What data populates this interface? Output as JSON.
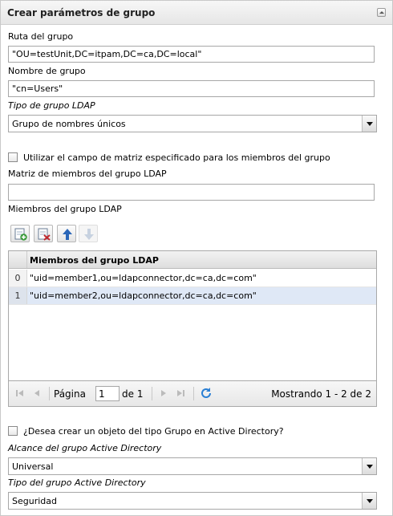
{
  "panel": {
    "title": "Crear parámetros de grupo"
  },
  "fields": {
    "group_path_label": "Ruta del grupo",
    "group_path_value": "\"OU=testUnit,DC=itpam,DC=ca,DC=local\"",
    "group_name_label": "Nombre de grupo",
    "group_name_value": "\"cn=Users\"",
    "ldap_type_label": "Tipo de grupo LDAP",
    "ldap_type_value": "Grupo de nombres únicos",
    "use_array_label": "Utilizar el campo de matriz especificado para los miembros del grupo",
    "member_array_label": "Matriz de miembros del grupo LDAP",
    "member_array_value": "",
    "members_label": "Miembros del grupo LDAP"
  },
  "grid": {
    "column_header": "Miembros del grupo LDAP",
    "rows": [
      {
        "index": "0",
        "value": "\"uid=member1,ou=ldapconnector,dc=ca,dc=com\""
      },
      {
        "index": "1",
        "value": "\"uid=member2,ou=ldapconnector,dc=ca,dc=com\""
      }
    ]
  },
  "pager": {
    "page_label": "Página",
    "page_value": "1",
    "of_label": "de 1",
    "info": "Mostrando 1 - 2 de 2"
  },
  "ad": {
    "create_label": "¿Desea crear un objeto del tipo Grupo en Active Directory?",
    "scope_label": "Alcance del grupo Active Directory",
    "scope_value": "Universal",
    "type_label": "Tipo del grupo Active Directory",
    "type_value": "Seguridad"
  },
  "icons": {
    "add_row": "add-row-icon",
    "delete_row": "delete-row-icon",
    "move_up": "arrow-up-icon",
    "move_down": "arrow-down-icon",
    "refresh": "refresh-icon"
  },
  "colors": {
    "selected_row": "#dfe8f6",
    "accent_blue": "#2a66b8"
  }
}
